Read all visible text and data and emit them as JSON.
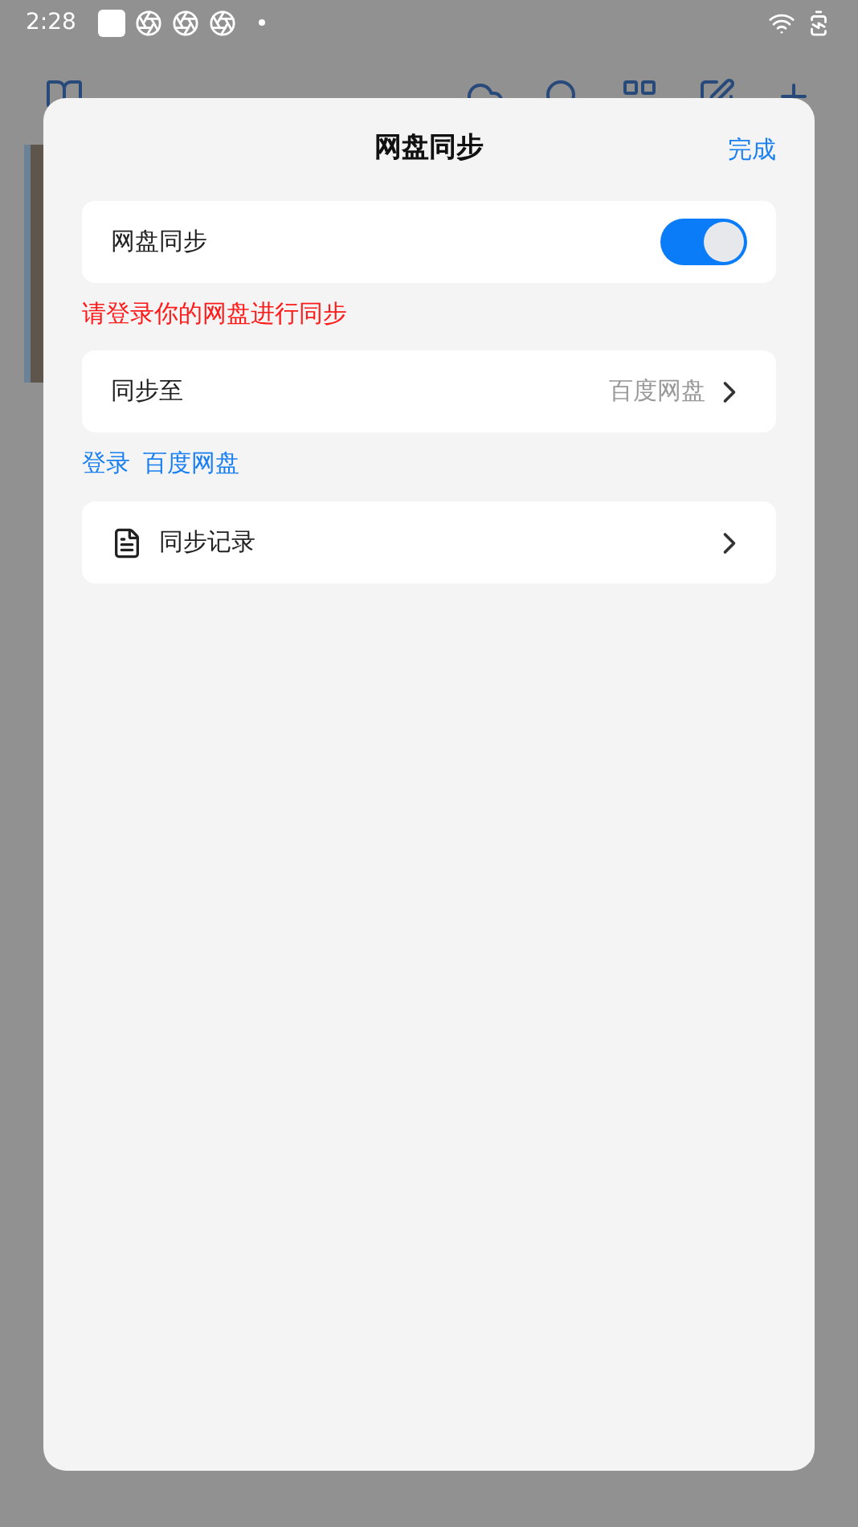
{
  "status_bar": {
    "time": "2:28"
  },
  "dialog": {
    "title": "网盘同步",
    "done": "完成",
    "sync_toggle": {
      "label": "网盘同步",
      "on": true
    },
    "warning": "请登录你的网盘进行同步",
    "sync_target": {
      "label": "同步至",
      "value": "百度网盘"
    },
    "login_links": [
      "登录",
      "百度网盘"
    ],
    "history": {
      "label": "同步记录"
    }
  }
}
